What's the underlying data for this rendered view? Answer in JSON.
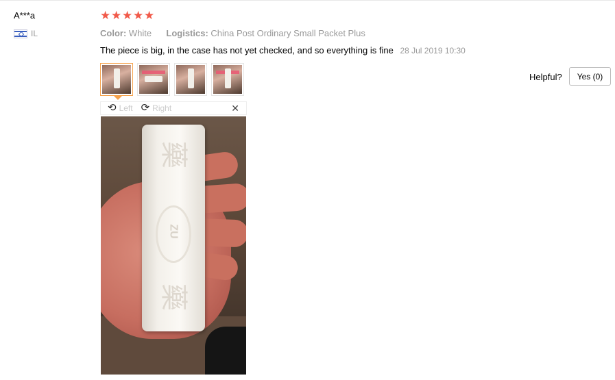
{
  "reviewer": {
    "name": "A***a",
    "country": "IL"
  },
  "rating": {
    "stars": 5,
    "max": 5,
    "color": "#f15a4a"
  },
  "meta": {
    "color_label": "Color:",
    "color_value": "White",
    "logistics_label": "Logistics:",
    "logistics_value": "China Post Ordinary Small Packet Plus"
  },
  "review": {
    "text": "The piece is big, in the case has not yet checked, and so everything is fine",
    "date": "28 Jul 2019 10:30"
  },
  "thumbnails": [
    {
      "icon": "photo-thumbnail",
      "active": true
    },
    {
      "icon": "photo-thumbnail",
      "active": false
    },
    {
      "icon": "photo-thumbnail",
      "active": false
    },
    {
      "icon": "photo-thumbnail",
      "active": false
    }
  ],
  "viewer": {
    "rotate_left": "Left",
    "rotate_right": "Right",
    "close_icon": "close-icon"
  },
  "helpful": {
    "label": "Helpful?",
    "yes_button": "Yes (0)"
  },
  "colors": {
    "accent": "#f6a24c",
    "muted": "#999999"
  }
}
